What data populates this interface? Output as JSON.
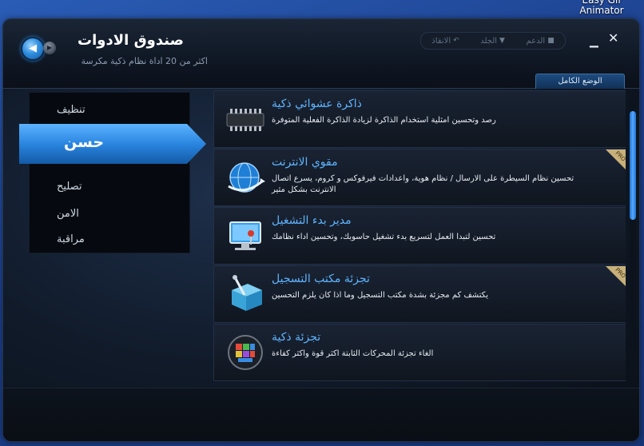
{
  "desktop": {
    "label": "Easy Gif Animator"
  },
  "app": {
    "title": "صندوق الادوات",
    "subtitle": "اكثر من 20 اداة نظام ذكية مكرسة"
  },
  "top_links": [
    "الدعم",
    "الجلد",
    "الانقاذ"
  ],
  "mode_tab": "الوضع الكامل",
  "sidebar": {
    "items": [
      "تنظيف",
      "حسن",
      "تصليح",
      "الامن",
      "مراقبة"
    ],
    "active": "حسن"
  },
  "tools": [
    {
      "title": "ذاكرة عشوائي ذكية",
      "desc": "رصد وتحسين امثلية استخدام الذاكرة لزيادة الذاكرة الفعلية المتوفرة",
      "pro": false,
      "icon": "ram-chip-icon"
    },
    {
      "title": "مقوي الانترنت",
      "desc": "تحسين نظام السيطرة على الارسال / نظام هوية، واعدادات فيرفوكس و كروم، يسرع اتصال الانترنت بشكل مثير",
      "pro": true,
      "icon": "globe-icon"
    },
    {
      "title": "مدير بدء التشغيل",
      "desc": "تحسين لتبدا العمل لتسريع بدء تشغيل حاسوبك، وتحسين اداء نظامك",
      "pro": false,
      "icon": "monitor-icon"
    },
    {
      "title": "تجزئة مكتب التسجيل",
      "desc": "يكتشف كم مجزئة بشدة مكتب التسجيل وما اذا كان يلزم التحسين",
      "pro": true,
      "icon": "registry-cube-icon"
    },
    {
      "title": "تجزئة ذكية",
      "desc": "الغاء تجزئة المحركات الثابتة اكثر قوة واكثر كفاءة",
      "pro": false,
      "icon": "defrag-disk-icon"
    }
  ],
  "pro_badge": "PRO",
  "colors": {
    "accent": "#2f8ee0",
    "title_blue": "#5fb4ff"
  }
}
